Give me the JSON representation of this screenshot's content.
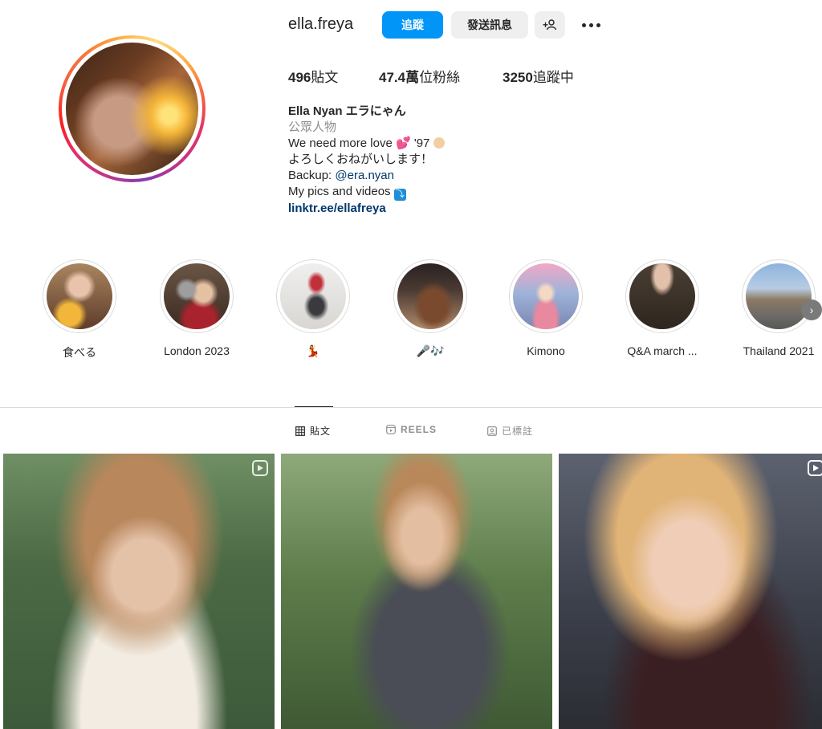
{
  "profile": {
    "username": "ella.freya",
    "follow_label": "追蹤",
    "message_label": "發送訊息",
    "suggest_label": "+",
    "stats": {
      "posts_count": "496",
      "posts_label": "貼文",
      "followers_count": "47.4萬",
      "followers_label": "位粉絲",
      "following_count": "3250",
      "following_label": "追蹤中"
    },
    "bio": {
      "name": "Ella Nyan エラにゃん",
      "category": "公眾人物",
      "line1_text": "We need more love ",
      "line1_heart": "💕",
      "line1_year": " '97 ",
      "line2": "よろしくおねがいします！",
      "line3_prefix": "Backup: ",
      "line3_mention": "@era.nyan",
      "line4_text": "My pics and videos ",
      "line4_arrow": "⤵",
      "link": "linktr.ee/ellafreya"
    }
  },
  "highlights": [
    {
      "label": "食べる"
    },
    {
      "label": "London 2023"
    },
    {
      "label": "💃"
    },
    {
      "label": "🎤🎶"
    },
    {
      "label": "Kimono"
    },
    {
      "label": "Q&A march ..."
    },
    {
      "label": "Thailand 2021"
    }
  ],
  "tabs": {
    "posts": "貼文",
    "reels": "REELS",
    "tagged": "已標註"
  },
  "icons": {
    "more": "more-icon",
    "add_person": "add-person-icon",
    "grid": "grid-icon",
    "reels": "reels-icon",
    "tagged": "tagged-icon",
    "next": "chevron-right-icon"
  },
  "colors": {
    "follow_button": "#0095f6",
    "link": "#00376b",
    "secondary_button": "#efefef"
  }
}
